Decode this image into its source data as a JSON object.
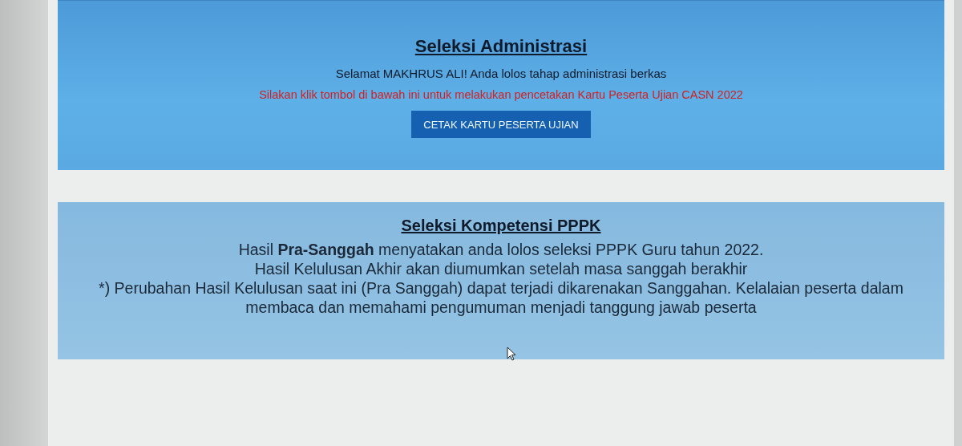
{
  "admin": {
    "title": "Seleksi Administrasi",
    "greeting": "Selamat MAKHRUS ALI! Anda lolos tahap administrasi berkas",
    "instruction": "Silakan klik tombol di bawah ini untuk melakukan pencetakan Kartu Peserta Ujian CASN 2022",
    "button": "CETAK KARTU PESERTA UJIAN"
  },
  "competency": {
    "title": "Seleksi Kompetensi PPPK",
    "lines": [
      "Hasil **Pra-Sanggah** menyatakan anda lolos seleksi PPPK Guru tahun 2022.",
      "Hasil Kelulusan Akhir akan diumumkan setelah masa sanggah berakhir",
      "*) Perubahan Hasil Kelulusan saat ini (Pra Sanggah) dapat terjadi dikarenakan Sanggahan. Kelalaian peserta dalam membaca dan memahami pengumuman menjadi tanggung jawab peserta"
    ]
  }
}
